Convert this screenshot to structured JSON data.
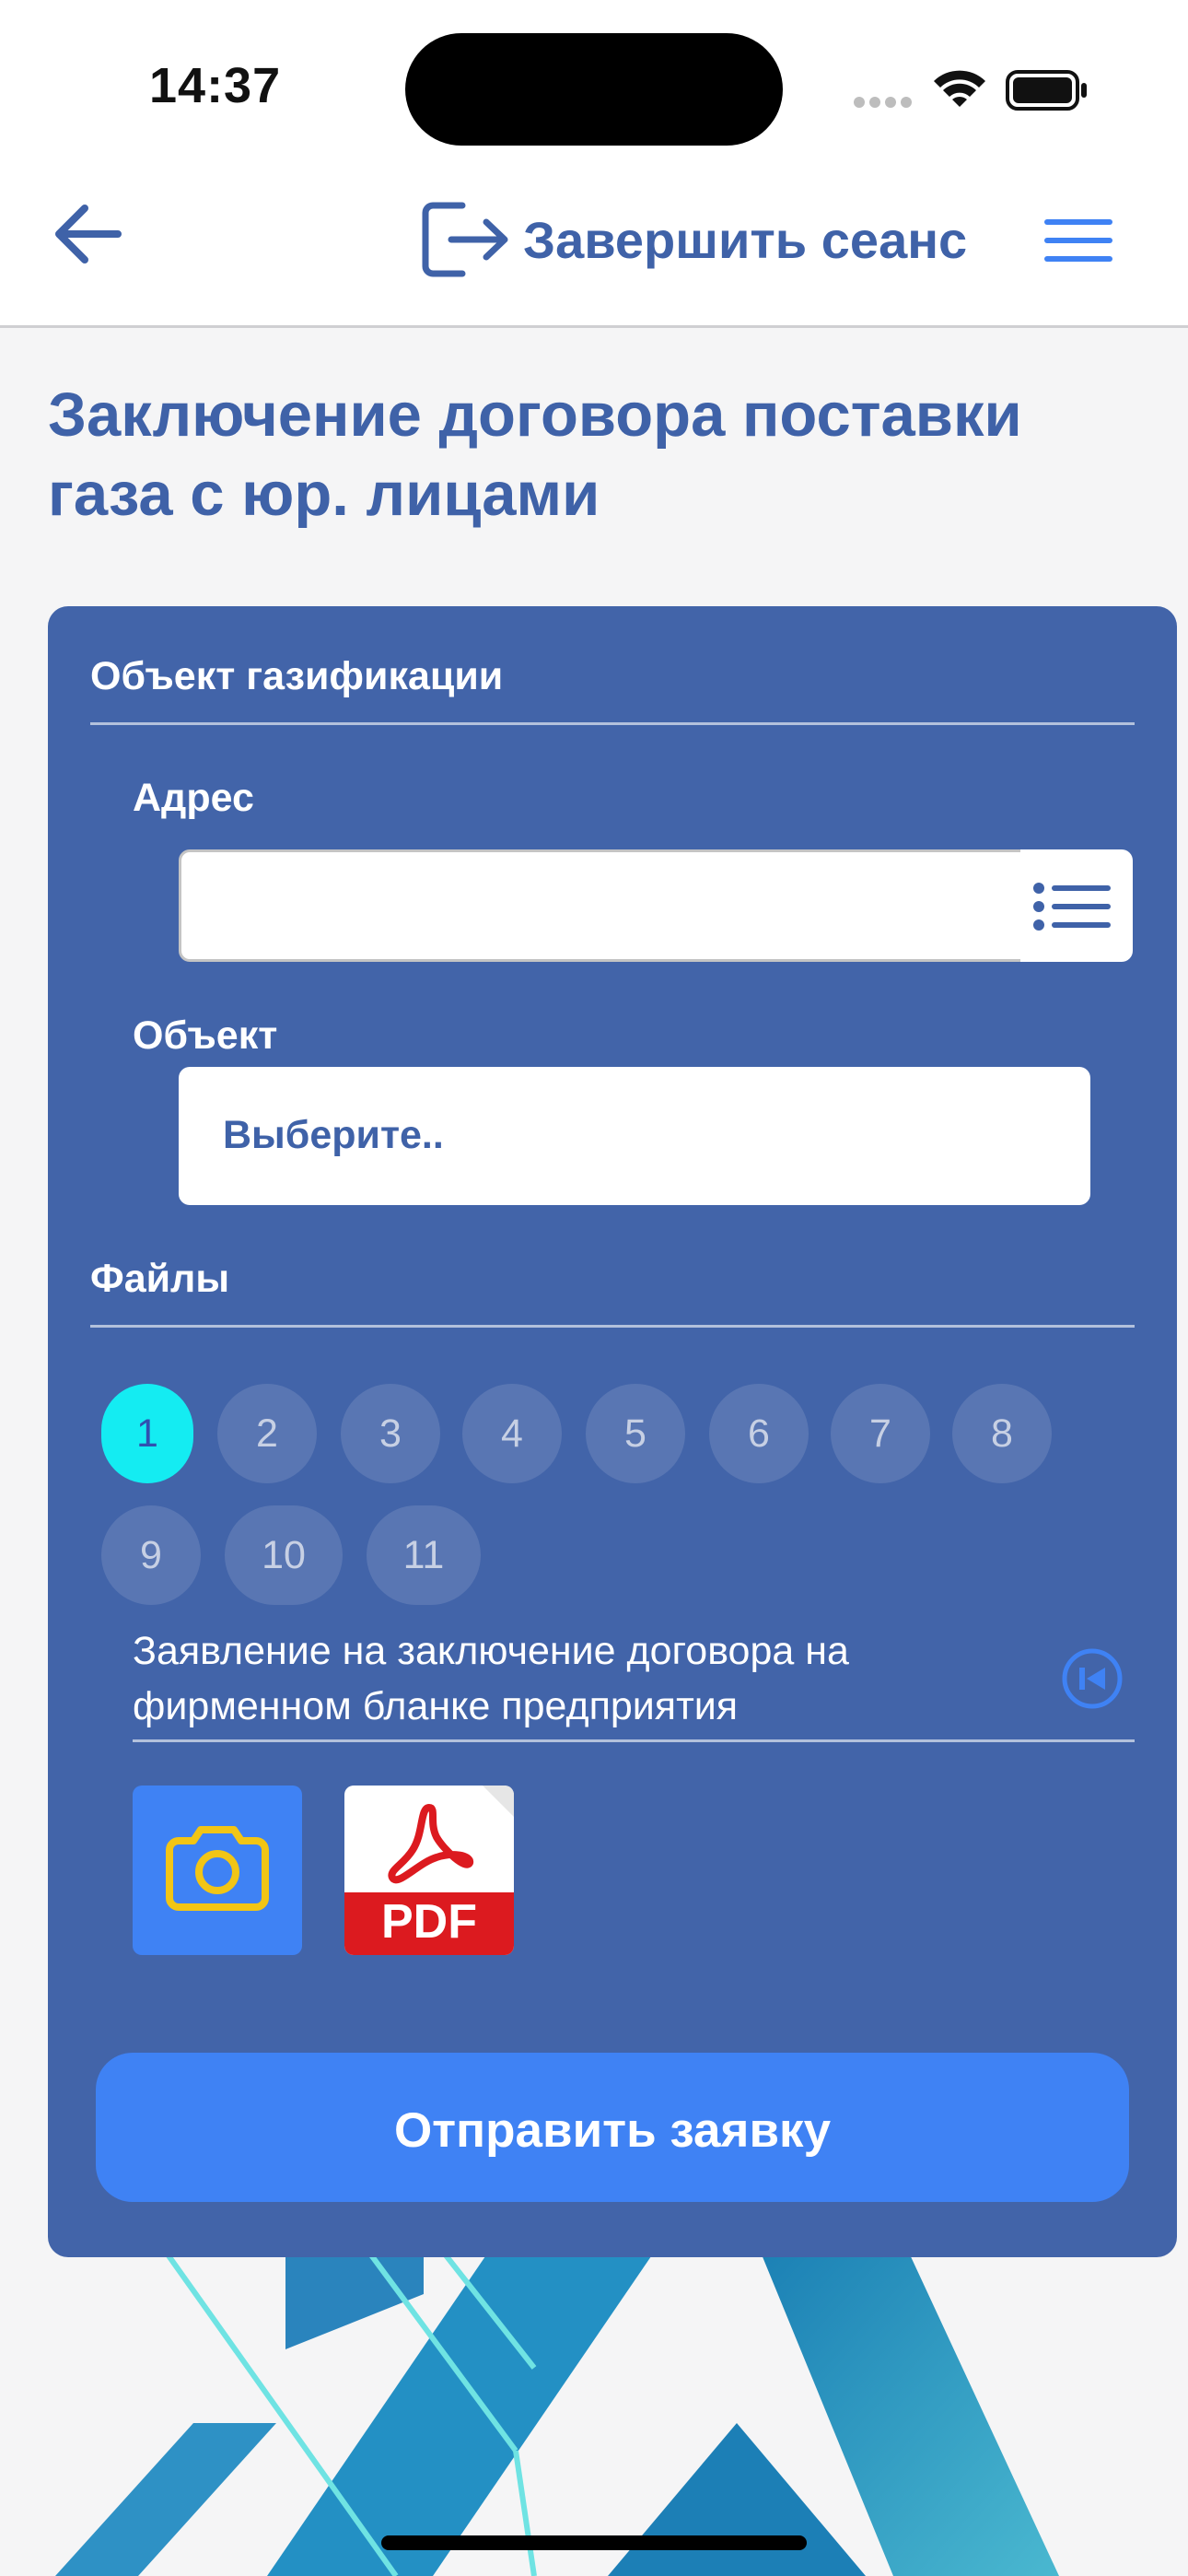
{
  "status_bar": {
    "time": "14:37"
  },
  "nav": {
    "back_icon": "arrow-left-icon",
    "logout_icon": "logout-icon",
    "logout_label": "Завершить сеанс",
    "menu_icon": "hamburger-menu-icon"
  },
  "page_title": "Заключение договора поставки газа с юр. лицами",
  "form": {
    "section_object": "Объект газификации",
    "address_label": "Адрес",
    "address_value": "",
    "address_list_icon": "list-icon",
    "object_label": "Объект",
    "object_placeholder": "Выберите..",
    "section_files": "Файлы",
    "file_pages": [
      "1",
      "2",
      "3",
      "4",
      "5",
      "6",
      "7",
      "8",
      "9",
      "10",
      "11"
    ],
    "active_page": "1",
    "file_description": "Заявление на заключение договора на фирменном бланке предприятия",
    "reset_icon": "skip-back-icon",
    "camera_icon": "camera-icon",
    "pdf_label": "PDF",
    "submit_label": "Отправить заявку"
  },
  "colors": {
    "primary": "#3f62a8",
    "card": "#4264a9",
    "accent_blue": "#3f82f4",
    "active_page": "#14ecf2",
    "camera_icon": "#f2c515",
    "pdf_red": "#dc1a1f"
  }
}
